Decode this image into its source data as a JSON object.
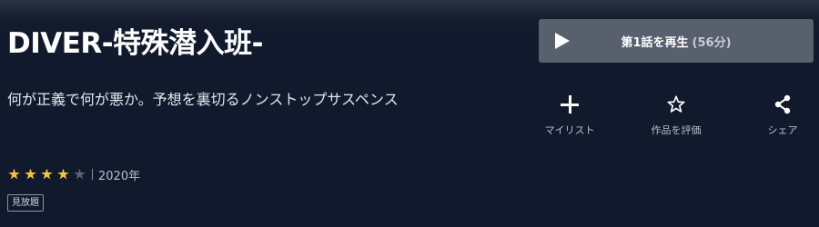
{
  "title": "DIVER-特殊潜入班-",
  "description": "何が正義で何が悪か。予想を裏切るノンストップサスペンス",
  "rating": {
    "value": 4,
    "max": 5
  },
  "year": "2020年",
  "badge": "見放題",
  "play": {
    "label": "第1話を再生",
    "duration": "(56分)"
  },
  "actions": [
    {
      "label": "マイリスト",
      "icon": "plus-icon"
    },
    {
      "label": "作品を評価",
      "icon": "star-outline-icon"
    },
    {
      "label": "シェア",
      "icon": "share-icon"
    }
  ],
  "colors": {
    "background": "#111a2c",
    "star_on": "#f5c242",
    "play_button": "#585f6d"
  }
}
